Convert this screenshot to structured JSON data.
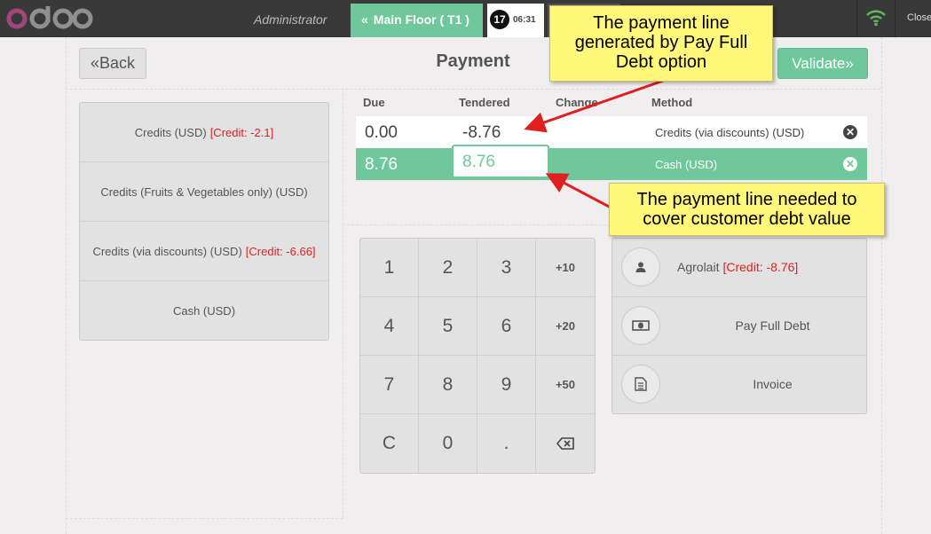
{
  "header": {
    "logo_text": "odoo",
    "cashier": "Administrator",
    "floor_tab": "Main Floor ( T1 )",
    "order_number": "17",
    "order_time": "06:31",
    "close_label": "Close",
    "accent_color": "#6ec89b"
  },
  "screen": {
    "back_label": "Back",
    "title": "Payment",
    "validate_label": "Validate"
  },
  "payment_methods": [
    {
      "label": "Credits (USD)",
      "credit": "[Credit: -2.1]"
    },
    {
      "label": "Credits (Fruits & Vegetables only) (USD)",
      "credit": ""
    },
    {
      "label": "Credits (via discounts) (USD)",
      "credit": "[Credit: -6.66]"
    },
    {
      "label": "Cash (USD)",
      "credit": ""
    }
  ],
  "lines_header": {
    "due": "Due",
    "tendered": "Tendered",
    "change": "Change",
    "method": "Method"
  },
  "payment_lines": [
    {
      "due": "0.00",
      "tendered": "-8.76",
      "method": "Credits (via discounts) (USD)"
    },
    {
      "due": "8.76",
      "tendered": "8.76",
      "method": "Cash (USD)"
    }
  ],
  "numpad": [
    "1",
    "2",
    "3",
    "+10",
    "4",
    "5",
    "6",
    "+20",
    "7",
    "8",
    "9",
    "+50",
    "C",
    "0",
    ".",
    "backspace"
  ],
  "customer": {
    "name": "Agrolait",
    "credit": "[Credit: -8.76]"
  },
  "actions": {
    "pay_full_debt": "Pay Full Debt",
    "invoice": "Invoice"
  },
  "callouts": {
    "top": [
      "The payment line",
      "generated by Pay Full",
      "Debt option"
    ],
    "bottom": [
      "The payment line needed to",
      "cover customer debt value"
    ]
  },
  "icons": {
    "back": "double-chevron-left-icon",
    "validate": "double-chevron-right-icon",
    "wifi": "wifi-icon",
    "customer": "user-icon",
    "pay_full_debt": "money-icon",
    "invoice": "document-icon",
    "delete": "close-circle-icon",
    "backspace": "backspace-icon"
  }
}
